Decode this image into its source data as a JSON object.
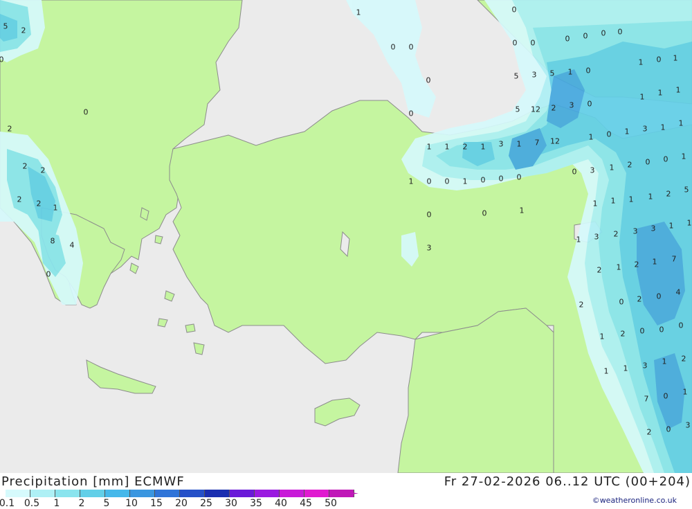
{
  "map": {
    "colors": {
      "sea": "#ebebeb",
      "land": "#c5f5a0",
      "border": "#8c8c8c",
      "precip_0_1": "#d6fafc",
      "precip_0_5": "#aef0f5",
      "precip_1": "#8ae4ee",
      "precip_2": "#62cfe8",
      "precip_5": "#45a8e0"
    },
    "values": [
      "1",
      "0",
      "5",
      "2",
      "0",
      "0",
      "0",
      "0",
      "0",
      "0",
      "2",
      "0",
      "0",
      "0",
      "0",
      "0",
      "0",
      "5",
      "3",
      "5",
      "1",
      "0",
      "5",
      "12",
      "2",
      "3",
      "0",
      "1",
      "1",
      "1",
      "1",
      "0",
      "1",
      "1",
      "1",
      "2",
      "1",
      "3",
      "1",
      "7",
      "12",
      "1",
      "0",
      "1",
      "3",
      "1",
      "1",
      "2",
      "2",
      "2",
      "0",
      "0",
      "1",
      "1",
      "0",
      "0",
      "1",
      "0",
      "0",
      "0",
      "0",
      "3",
      "1",
      "2",
      "2",
      "1",
      "1",
      "1",
      "1",
      "1",
      "2",
      "5",
      "0",
      "0",
      "1",
      "1",
      "3",
      "2",
      "3",
      "3",
      "1",
      "1",
      "8",
      "4",
      "2",
      "1",
      "2",
      "1",
      "7",
      "3",
      "0",
      "0",
      "2",
      "0",
      "4",
      "2",
      "1",
      "2",
      "0",
      "0",
      "0",
      "1",
      "1",
      "3",
      "1",
      "2",
      "7",
      "0",
      "1",
      "2",
      "0",
      "3"
    ]
  },
  "footer": {
    "title": "Precipitation [mm] ECMWF",
    "datetime": "Fr 27-02-2026 06..12 UTC (00+204)",
    "credit": "©weatheronline.co.uk",
    "legend": {
      "labels": [
        "0.1",
        "0.5",
        "1",
        "2",
        "5",
        "10",
        "15",
        "20",
        "25",
        "30",
        "35",
        "40",
        "45",
        "50"
      ],
      "colors": [
        "#d6fafc",
        "#aef0f5",
        "#8ae4ee",
        "#62cfe8",
        "#45b8ea",
        "#3a96e0",
        "#2f74d8",
        "#2550c8",
        "#1a2eb0",
        "#6a1ad8",
        "#9a1ae0",
        "#c81ad8",
        "#e01ad0",
        "#c018b8"
      ]
    }
  }
}
